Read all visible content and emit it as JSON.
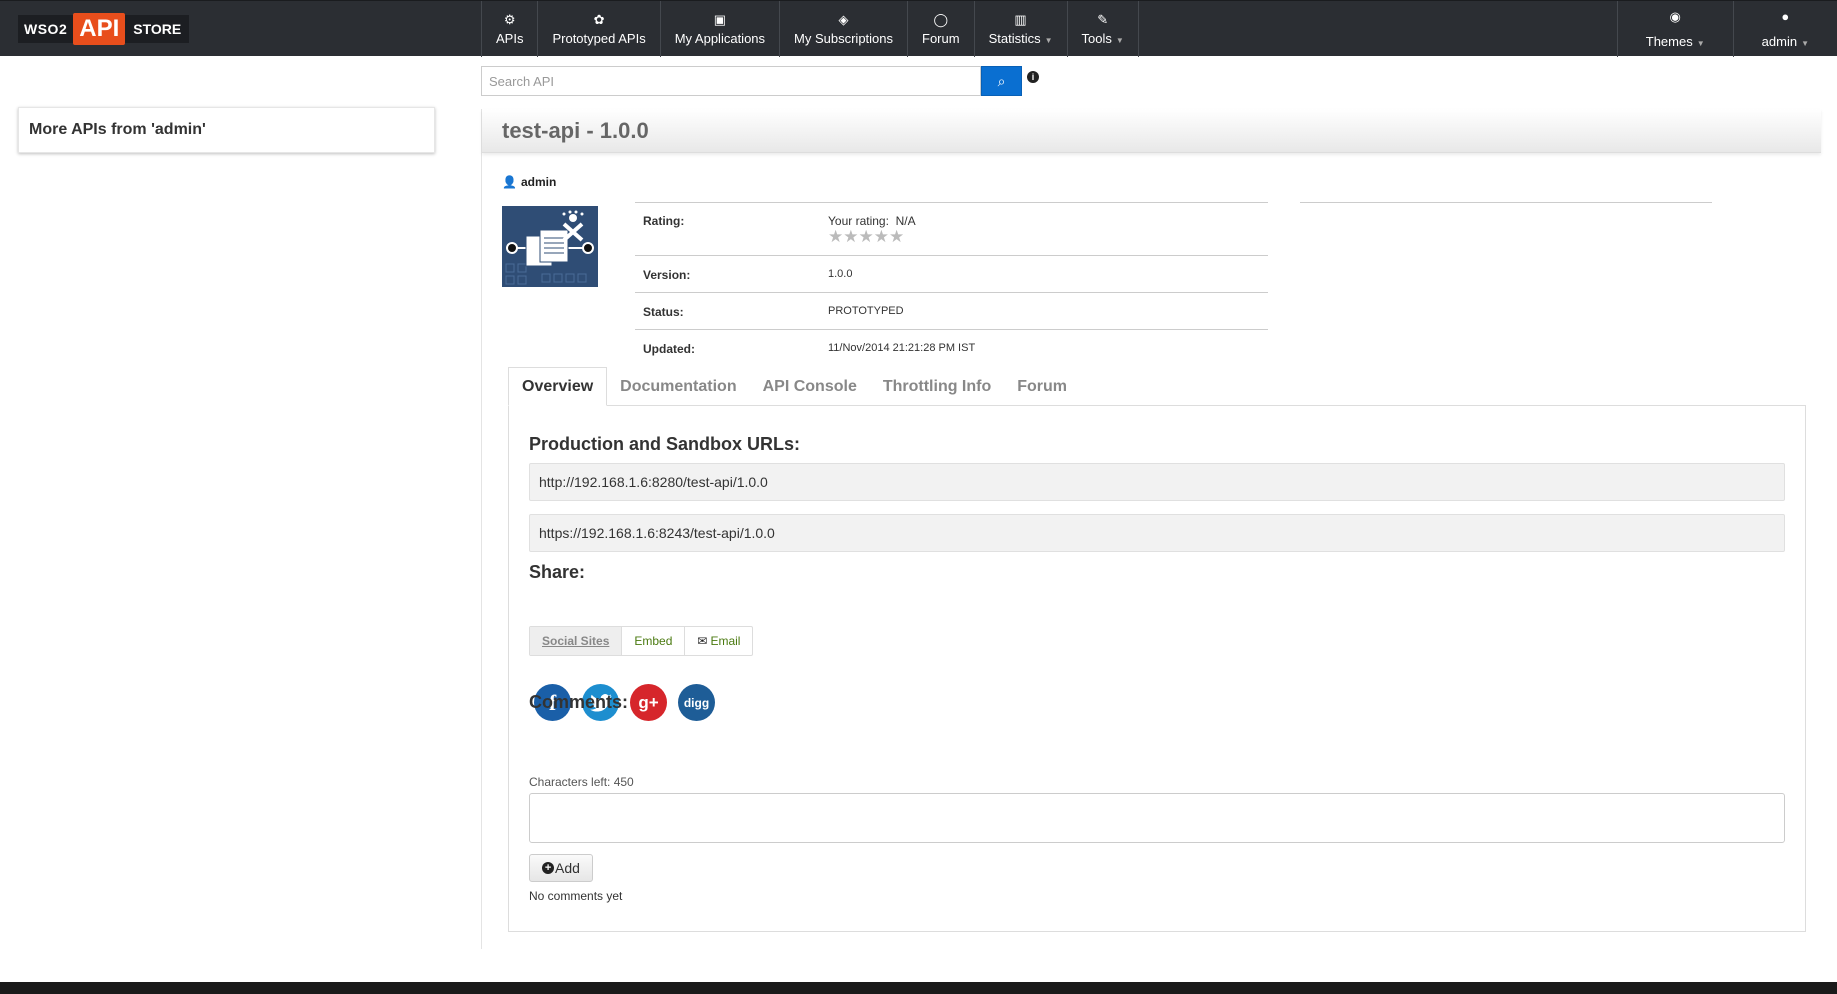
{
  "logo": {
    "wso2": "WSO2",
    "api": "API",
    "store": "STORE"
  },
  "nav": {
    "items": [
      {
        "label": "APIs",
        "icon": "gears-icon",
        "glyph": "⚙"
      },
      {
        "label": "Prototyped APIs",
        "icon": "cog-icon",
        "glyph": "✿"
      },
      {
        "label": "My Applications",
        "icon": "briefcase-icon",
        "glyph": "▣"
      },
      {
        "label": "My Subscriptions",
        "icon": "tags-icon",
        "glyph": "◈"
      },
      {
        "label": "Forum",
        "icon": "comment-icon",
        "glyph": "◯"
      },
      {
        "label": "Statistics",
        "icon": "chart-icon",
        "glyph": "▥"
      },
      {
        "label": "Tools",
        "icon": "wrench-icon",
        "glyph": "✎"
      }
    ],
    "themes": "Themes",
    "user": "admin"
  },
  "search": {
    "placeholder": "Search API"
  },
  "sidebar": {
    "title": "More APIs from 'admin'"
  },
  "api": {
    "title": "test-api - 1.0.0",
    "owner": "admin",
    "rating_label": "Rating:",
    "your_rating_label": "Your rating:",
    "your_rating_value": "N/A",
    "stars": "★★★★★",
    "version_label": "Version:",
    "version": "1.0.0",
    "status_label": "Status:",
    "status": "PROTOTYPED",
    "updated_label": "Updated:",
    "updated": "11/Nov/2014 21:21:28 PM IST"
  },
  "tabs": [
    "Overview",
    "Documentation",
    "API Console",
    "Throttling Info",
    "Forum"
  ],
  "overview": {
    "urls_title": "Production and Sandbox URLs:",
    "url_http": "http://192.168.1.6:8280/test-api/1.0.0",
    "url_https": "https://192.168.1.6:8243/test-api/1.0.0",
    "share_title": "Share:",
    "share_tabs": [
      "Social Sites",
      "Embed",
      "Email"
    ],
    "social": [
      {
        "name": "facebook",
        "glyph": "f",
        "color": "#1a5fa8"
      },
      {
        "name": "twitter",
        "glyph": "t",
        "color": "#1d8ecf"
      },
      {
        "name": "googleplus",
        "glyph": "g+",
        "color": "#d6262b"
      },
      {
        "name": "digg",
        "glyph": "digg",
        "color": "#1e5d97"
      }
    ],
    "comments_title": "Comments:",
    "chars_left": "Characters left: 450",
    "add_label": "Add",
    "no_comments": "No comments yet"
  },
  "colors": {
    "topbar": "#2b2e33",
    "accent": "#e84e1c",
    "search_button": "#0a6fd1"
  }
}
